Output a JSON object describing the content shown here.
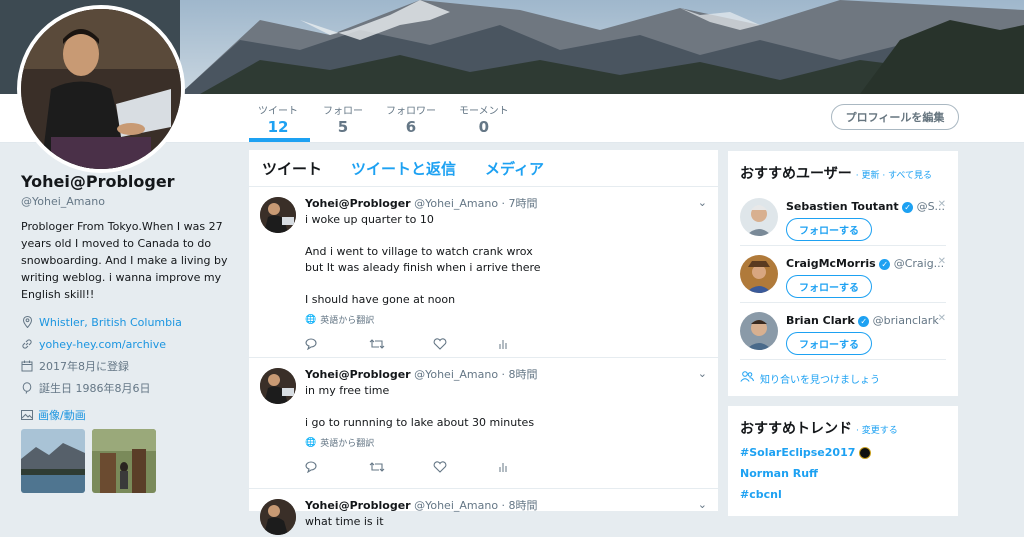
{
  "profile": {
    "name": "Yohei@Probloger",
    "handle": "@Yohei_Amano",
    "bio": "Probloger From Tokyo.When I was 27 years old I moved to Canada to do snowboarding. And I make a living by writing weblog. i wanna improve my English skill!!",
    "location": "Whistler, British Columbia",
    "website": "yohey-hey.com/archive",
    "joined": "2017年8月に登録",
    "birthday": "誕生日 1986年8月6日",
    "media_label": "画像/動画"
  },
  "stats": [
    {
      "label": "ツイート",
      "value": "12"
    },
    {
      "label": "フォロー",
      "value": "5"
    },
    {
      "label": "フォロワー",
      "value": "6"
    },
    {
      "label": "モーメント",
      "value": "0"
    }
  ],
  "edit_profile_label": "プロフィールを編集",
  "timeline_tabs": [
    "ツイート",
    "ツイートと返信",
    "メディア"
  ],
  "tweets": [
    {
      "name": "Yohei@Probloger",
      "meta": "@Yohei_Amano · 7時間",
      "text": "i woke up  quarter to 10\n\nAnd i went to village to watch crank wrox\nbut It was aleady finish when i arrive there\n\nI should have gone at noon",
      "translate": "英語から翻訳"
    },
    {
      "name": "Yohei@Probloger",
      "meta": "@Yohei_Amano · 8時間",
      "text": "in my free time\n\ni go to runnning to lake about 30 minutes",
      "translate": "英語から翻訳"
    },
    {
      "name": "Yohei@Probloger",
      "meta": "@Yohei_Amano · 8時間",
      "text": "what time is it",
      "translate": ""
    }
  ],
  "suggestions": {
    "title": "おすすめユーザー",
    "links": "· 更新 · すべて見る",
    "follow_label": "フォローする",
    "users": [
      {
        "name": "Sebastien Toutant",
        "handle": "@S..."
      },
      {
        "name": "CraigMcMorris",
        "handle": "@Craig..."
      },
      {
        "name": "Brian Clark",
        "handle": "@brianclark"
      }
    ],
    "find_friends": "知り合いを見つけましょう"
  },
  "trends": {
    "title": "おすすめトレンド",
    "change": "· 変更する",
    "items": [
      "#SolarEclipse2017",
      "Norman Ruff",
      "#cbcnl"
    ]
  },
  "colors": {
    "accent": "#1da1f2",
    "background": "#e6ecf0"
  }
}
